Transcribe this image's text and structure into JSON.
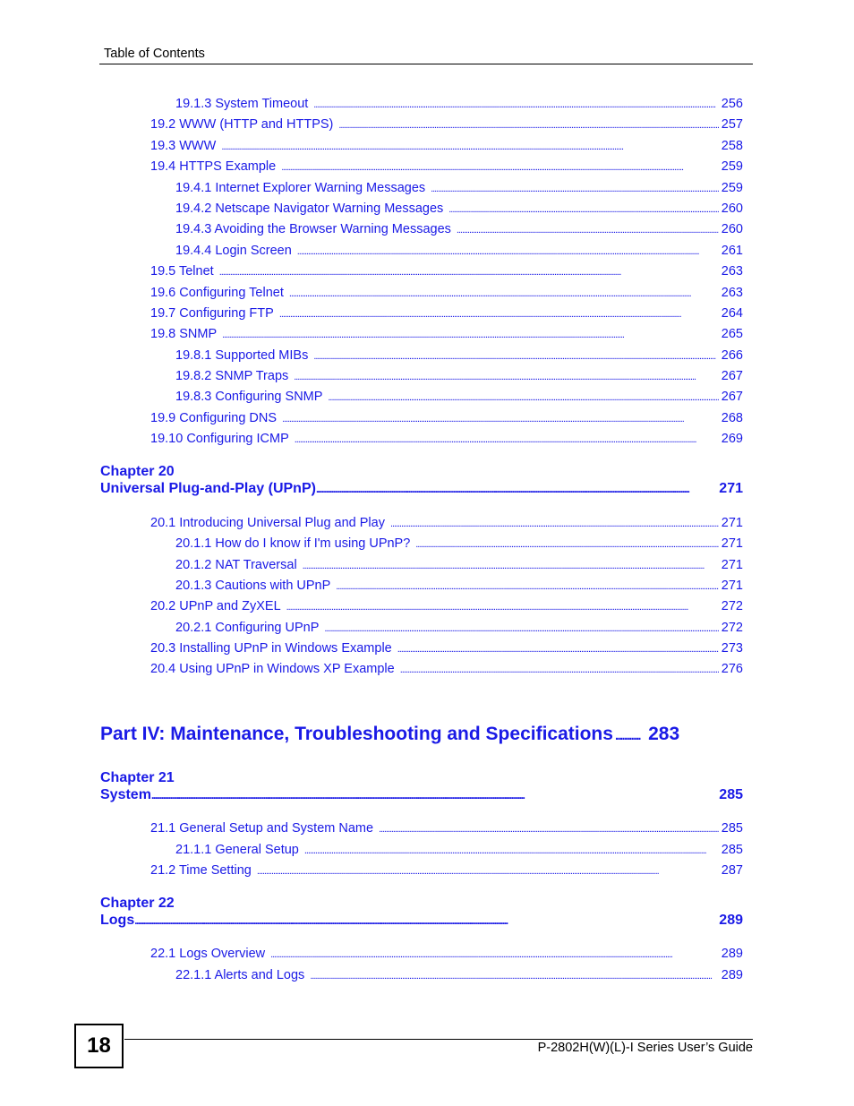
{
  "header": {
    "title": "Table of Contents"
  },
  "entries_top": [
    {
      "number": "19.1.3",
      "title": "System Timeout",
      "page": "256",
      "level": 3
    },
    {
      "number": "19.2",
      "title": "WWW (HTTP and HTTPS)",
      "page": "257",
      "level": 2
    },
    {
      "number": "19.3",
      "title": "WWW",
      "page": "258",
      "level": 2
    },
    {
      "number": "19.4",
      "title": "HTTPS Example",
      "page": "259",
      "level": 2
    },
    {
      "number": "19.4.1",
      "title": "Internet Explorer Warning Messages",
      "page": "259",
      "level": 3
    },
    {
      "number": "19.4.2",
      "title": "Netscape Navigator Warning Messages",
      "page": "260",
      "level": 3
    },
    {
      "number": "19.4.3",
      "title": "Avoiding the Browser Warning Messages",
      "page": "260",
      "level": 3
    },
    {
      "number": "19.4.4",
      "title": "Login Screen",
      "page": "261",
      "level": 3
    },
    {
      "number": "19.5",
      "title": "Telnet",
      "page": "263",
      "level": 2
    },
    {
      "number": "19.6",
      "title": "Configuring Telnet",
      "page": "263",
      "level": 2
    },
    {
      "number": "19.7",
      "title": "Configuring FTP",
      "page": "264",
      "level": 2
    },
    {
      "number": "19.8",
      "title": "SNMP",
      "page": "265",
      "level": 2
    },
    {
      "number": "19.8.1",
      "title": "Supported MIBs",
      "page": "266",
      "level": 3
    },
    {
      "number": "19.8.2",
      "title": "SNMP Traps",
      "page": "267",
      "level": 3
    },
    {
      "number": "19.8.3",
      "title": "Configuring SNMP",
      "page": "267",
      "level": 3
    },
    {
      "number": "19.9",
      "title": "Configuring DNS",
      "page": "268",
      "level": 2
    },
    {
      "number": "19.10",
      "title": "Configuring ICMP",
      "page": "269",
      "level": 2
    }
  ],
  "labels_top": [
    "19.1.3  System Timeout",
    "19.2 WWW (HTTP and HTTPS)",
    "19.3 WWW",
    "19.4 HTTPS Example",
    "19.4.1 Internet Explorer Warning Messages",
    "19.4.2 Netscape Navigator Warning Messages",
    "19.4.3 Avoiding the Browser Warning Messages",
    "19.4.4 Login Screen",
    "19.5 Telnet",
    "19.6 Configuring Telnet",
    "19.7 Configuring FTP",
    "19.8 SNMP",
    "19.8.1 Supported MIBs",
    "19.8.2 SNMP Traps",
    "19.8.3 Configuring SNMP",
    "19.9 Configuring DNS",
    "19.10 Configuring ICMP"
  ],
  "chapter20": {
    "label": "Chapter  20",
    "title": "Universal Plug-and-Play (UPnP)",
    "page": "271",
    "entries": [
      {
        "label": "20.1 Introducing Universal Plug and Play",
        "page": "271",
        "level": 2
      },
      {
        "label": "20.1.1 How do I know if I'm using UPnP?",
        "page": "271",
        "level": 3
      },
      {
        "label": "20.1.2 NAT Traversal",
        "page": "271",
        "level": 3
      },
      {
        "label": "20.1.3 Cautions with UPnP",
        "page": "271",
        "level": 3
      },
      {
        "label": "20.2 UPnP and ZyXEL",
        "page": "272",
        "level": 2
      },
      {
        "label": "20.2.1 Configuring UPnP",
        "page": "272",
        "level": 3
      },
      {
        "label": "20.3 Installing UPnP in Windows Example",
        "page": "273",
        "level": 2
      },
      {
        "label": "20.4 Using UPnP in Windows XP Example",
        "page": "276",
        "level": 2
      }
    ]
  },
  "part4": {
    "title": "Part IV: Maintenance, Troubleshooting and Specifications",
    "page": "283"
  },
  "chapter21": {
    "label": "Chapter  21",
    "title": "System",
    "page": "285",
    "entries": [
      {
        "label": "21.1 General Setup and System Name",
        "page": "285",
        "level": 2
      },
      {
        "label": "21.1.1 General Setup",
        "page": "285",
        "level": 3
      },
      {
        "label": "21.2 Time Setting",
        "page": "287",
        "level": 2
      }
    ]
  },
  "chapter22": {
    "label": "Chapter  22",
    "title": "Logs",
    "page": "289",
    "entries": [
      {
        "label": "22.1 Logs Overview",
        "page": "289",
        "level": 2
      },
      {
        "label": "22.1.1 Alerts and Logs",
        "page": "289",
        "level": 3
      }
    ]
  },
  "footer": {
    "page_number": "18",
    "guide_title": "P-2802H(W)(L)-I Series User’s Guide"
  },
  "colors": {
    "link": "#1a1ae6",
    "text": "#000000"
  }
}
